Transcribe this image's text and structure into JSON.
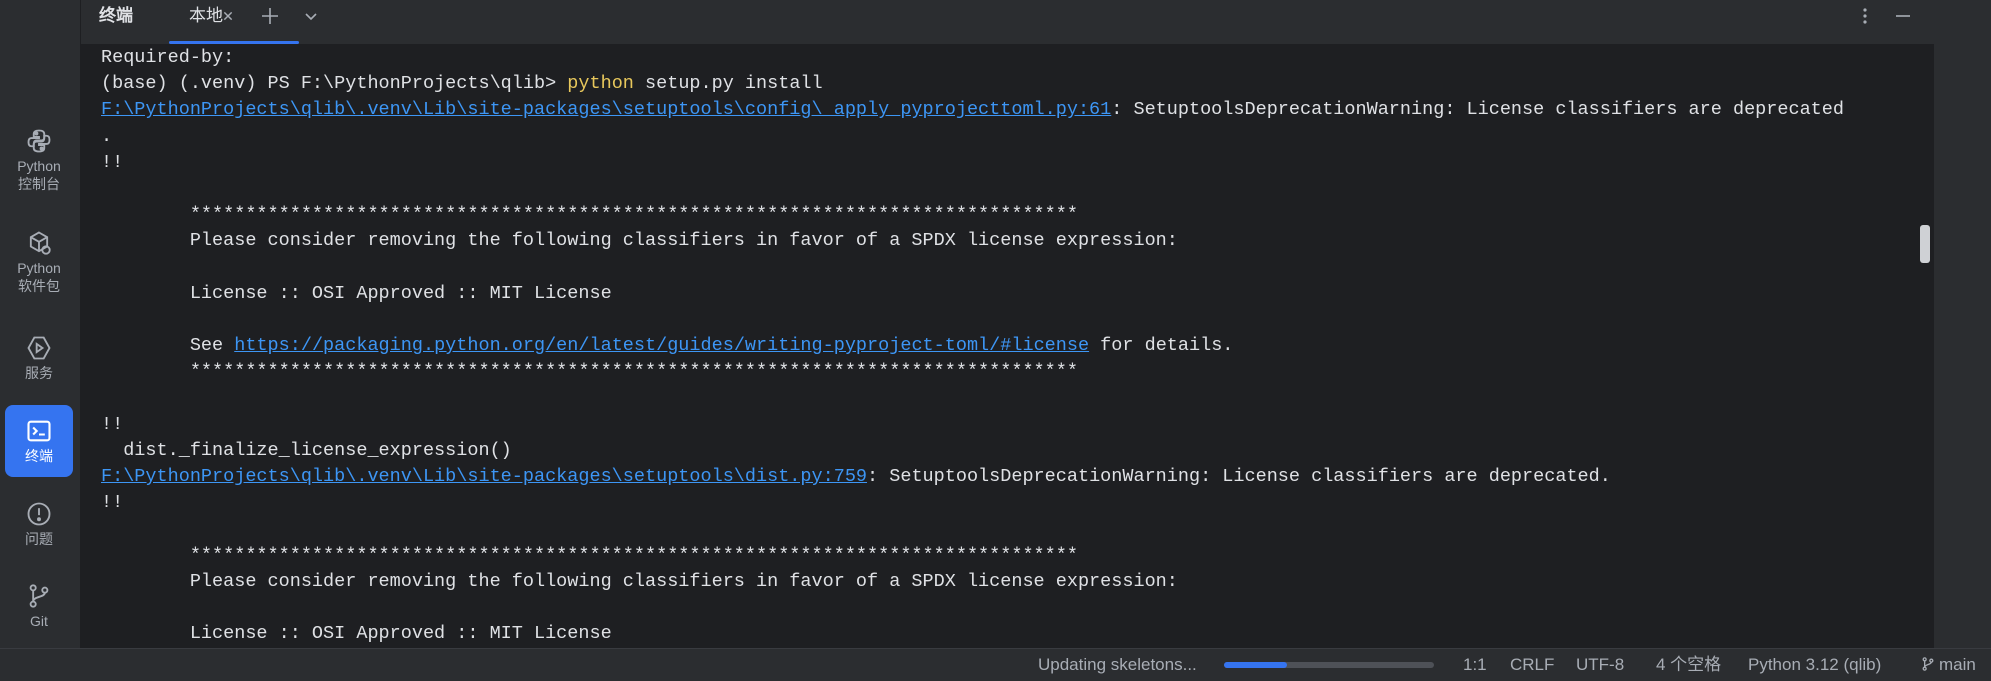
{
  "sidebar": {
    "items": [
      {
        "label": "Python\n控制台",
        "icon": "python-icon",
        "active": false
      },
      {
        "label": "Python\n软件包",
        "icon": "packages-icon",
        "active": false
      },
      {
        "label": "服务",
        "icon": "services-icon",
        "active": false
      },
      {
        "label": "终端",
        "icon": "terminal-icon",
        "active": true
      },
      {
        "label": "问题",
        "icon": "problems-icon",
        "active": false
      },
      {
        "label": "Git",
        "icon": "git-icon",
        "active": false
      }
    ]
  },
  "header": {
    "title": "终端",
    "tab_label": "本地",
    "icons": [
      "close-icon",
      "plus-icon",
      "chevron-down-icon",
      "more-vertical-icon",
      "minimize-icon"
    ]
  },
  "terminal": {
    "lines": [
      [
        {
          "t": "Required-by:"
        }
      ],
      [
        {
          "t": "(base) (.venv) PS F:\\PythonProjects\\qlib> "
        },
        {
          "t": "python",
          "k": "cmd"
        },
        {
          "t": " setup.py install"
        }
      ],
      [
        {
          "t": "F:\\PythonProjects\\qlib\\.venv\\Lib\\site-packages\\setuptools\\config\\_apply_pyprojecttoml.py:61",
          "k": "link"
        },
        {
          "t": ": SetuptoolsDeprecationWarning: License classifiers are deprecated"
        }
      ],
      [
        {
          "t": "."
        }
      ],
      [
        {
          "t": "!!"
        }
      ],
      [
        {
          "t": ""
        }
      ],
      [
        {
          "t": "        ********************************************************************************"
        }
      ],
      [
        {
          "t": "        Please consider removing the following classifiers in favor of a SPDX license expression:"
        }
      ],
      [
        {
          "t": ""
        }
      ],
      [
        {
          "t": "        License :: OSI Approved :: MIT License"
        }
      ],
      [
        {
          "t": ""
        }
      ],
      [
        {
          "t": "        See "
        },
        {
          "t": "https://packaging.python.org/en/latest/guides/writing-pyproject-toml/#license",
          "k": "link"
        },
        {
          "t": " for details."
        }
      ],
      [
        {
          "t": "        ********************************************************************************"
        }
      ],
      [
        {
          "t": ""
        }
      ],
      [
        {
          "t": "!!"
        }
      ],
      [
        {
          "t": "  dist._finalize_license_expression()"
        }
      ],
      [
        {
          "t": "F:\\PythonProjects\\qlib\\.venv\\Lib\\site-packages\\setuptools\\dist.py:759",
          "k": "link"
        },
        {
          "t": ": SetuptoolsDeprecationWarning: License classifiers are deprecated."
        }
      ],
      [
        {
          "t": "!!"
        }
      ],
      [
        {
          "t": ""
        }
      ],
      [
        {
          "t": "        ********************************************************************************"
        }
      ],
      [
        {
          "t": "        Please consider removing the following classifiers in favor of a SPDX license expression:"
        }
      ],
      [
        {
          "t": ""
        }
      ],
      [
        {
          "t": "        License :: OSI Approved :: MIT License"
        }
      ]
    ]
  },
  "status": {
    "task": "Updating skeletons...",
    "progress": 0.3,
    "position": "1:1",
    "line_ending": "CRLF",
    "encoding": "UTF-8",
    "indent": "4 个空格",
    "interpreter": "Python 3.12 (qlib)",
    "branch": "main"
  },
  "colors": {
    "accent": "#3574f0",
    "link": "#3d96f5",
    "command": "#e7c75c"
  }
}
